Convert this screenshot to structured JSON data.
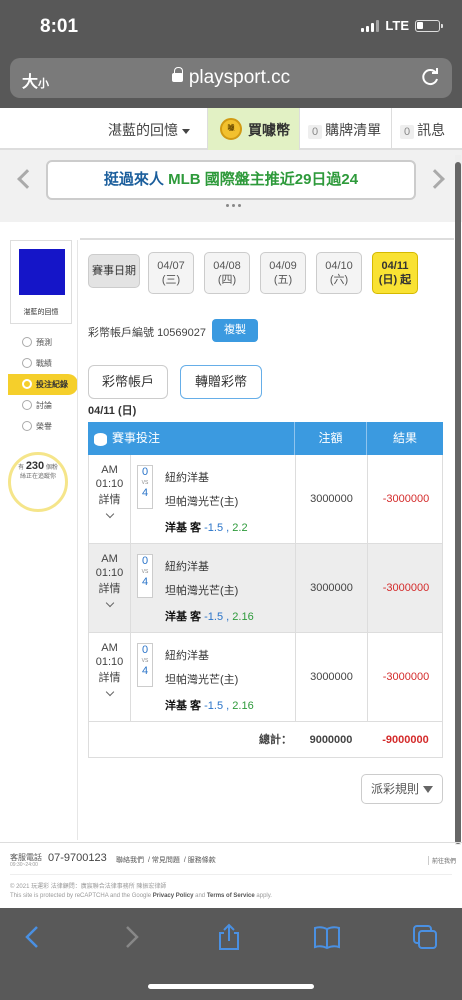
{
  "status": {
    "time": "8:01",
    "network": "LTE"
  },
  "browser": {
    "text_size": "大",
    "text_size_small": "小",
    "url": "playsport.cc"
  },
  "nav": {
    "user_name": "湛藍的回憶",
    "buy_coin_label": "買噱幣",
    "coin_icon_text": "噱",
    "cart_count": "0",
    "cart_label": "購牌清單",
    "msg_count": "0",
    "msg_label": "訊息"
  },
  "banner": {
    "part1": "挺過來人",
    "part2": "MLB 國際盤主推近29日過24"
  },
  "sidebar": {
    "user_name": "湛藍的回憶",
    "items": [
      {
        "label": "預測",
        "icon": "target-icon"
      },
      {
        "label": "戰績",
        "icon": "trophy-icon"
      },
      {
        "label": "投注紀錄",
        "icon": "record-icon",
        "active": true
      },
      {
        "label": "討論",
        "icon": "chat-icon"
      },
      {
        "label": "榮譽",
        "icon": "medal-icon"
      }
    ],
    "bulb_prefix": "有",
    "bulb_count": "230",
    "bulb_suffix": "個粉",
    "bulb_line2": "絲正在追蹤你"
  },
  "dates": {
    "label": "賽事日期",
    "items": [
      {
        "date": "04/07",
        "day": "(三)"
      },
      {
        "date": "04/08",
        "day": "(四)"
      },
      {
        "date": "04/09",
        "day": "(五)"
      },
      {
        "date": "04/10",
        "day": "(六)"
      },
      {
        "date": "04/11",
        "day": "(日) 起",
        "active": true
      }
    ]
  },
  "account": {
    "label": "彩幣帳戶編號",
    "number": "10569027",
    "copy_label": "複製"
  },
  "tabs": {
    "coin_account": "彩幣帳戶",
    "transfer": "轉贈彩幣"
  },
  "day_title": "04/11 (日)",
  "table": {
    "headers": {
      "event": "賽事投注",
      "amount": "注額",
      "result": "結果"
    },
    "rows": [
      {
        "ampm": "AM",
        "time": "01:10",
        "detail": "詳情",
        "score_a": "0",
        "vs": "VS",
        "score_b": "4",
        "team_a": "紐約洋基",
        "team_b": "坦帕灣光芒(主)",
        "pick_side": "洋基 客",
        "pick_line": "-1.5",
        "pick_sep": ",",
        "pick_odds": "2.2",
        "amount": "3000000",
        "result": "-3000000"
      },
      {
        "ampm": "AM",
        "time": "01:10",
        "detail": "詳情",
        "score_a": "0",
        "vs": "VS",
        "score_b": "4",
        "team_a": "紐約洋基",
        "team_b": "坦帕灣光芒(主)",
        "pick_side": "洋基 客",
        "pick_line": "-1.5",
        "pick_sep": ",",
        "pick_odds": "2.16",
        "amount": "3000000",
        "result": "-3000000"
      },
      {
        "ampm": "AM",
        "time": "01:10",
        "detail": "詳情",
        "score_a": "0",
        "vs": "VS",
        "score_b": "4",
        "team_a": "紐約洋基",
        "team_b": "坦帕灣光芒(主)",
        "pick_side": "洋基 客",
        "pick_line": "-1.5",
        "pick_sep": ",",
        "pick_odds": "2.16",
        "amount": "3000000",
        "result": "-3000000"
      }
    ],
    "total_label": "總計：",
    "total_amount": "9000000",
    "total_result": "-9000000"
  },
  "rules_label": "派彩規則",
  "footer": {
    "hotline_label": "客服電話",
    "hotline_hours": "09:30~24:00",
    "hotline_number": "07-9700123",
    "links": [
      "聯絡我們",
      "常見問題",
      "服務條款"
    ],
    "right": "前往我們",
    "copyright": "© 2021 玩運彩 法律顧問：廣宸聯合法律事務所 陳振宏律師",
    "recaptcha_pre": "This site is protected by reCAPTCHA and the Google",
    "privacy": "Privacy Policy",
    "and": "and",
    "terms": "Terms of Service",
    "apply": "apply."
  },
  "colors": {
    "accent_blue": "#3b9ae0",
    "loss_red": "#d42b2b",
    "odds_green": "#2e9a3b",
    "active_yellow": "#f9e233"
  }
}
